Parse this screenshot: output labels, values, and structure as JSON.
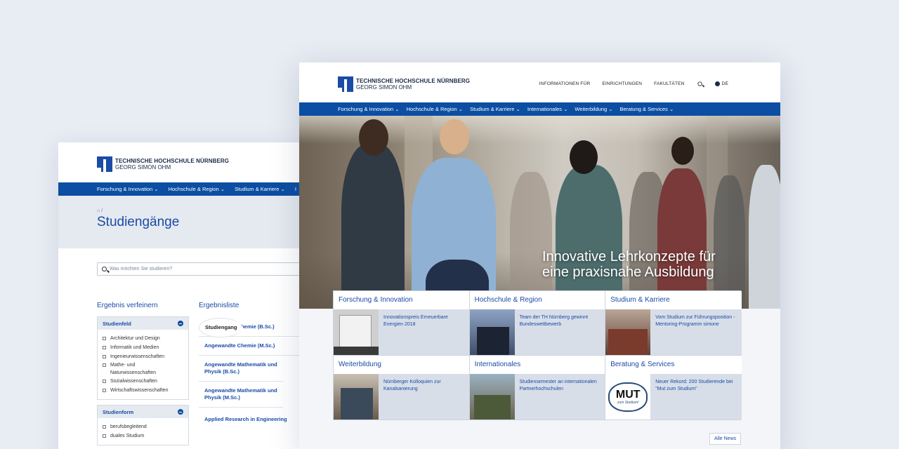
{
  "brand": {
    "line1": "TECHNISCHE HOCHSCHULE NÜRNBERG",
    "line2": "GEORG SIMON OHM",
    "accent": "#0b4ea2"
  },
  "back": {
    "nav": [
      "Forschung & Innovation ⌄",
      "Hochschule & Region ⌄",
      "Studium & Karriere ⌄",
      "I"
    ],
    "breadcrumb": "⌂ /",
    "title": "Studiengänge",
    "search_placeholder": "Was möchten Sie studieren?",
    "filter_title": "Ergebnis verfeinern",
    "filters": [
      {
        "name": "Studienfeld",
        "options": [
          "Architektur und Design",
          "Informatik und Medien",
          "Ingenieurwissenschaften",
          "Mathe- und Naturwissenschaften",
          "Sozialwissenschaften",
          "Wirtschaftswissenschaften"
        ]
      },
      {
        "name": "Studienform",
        "options": [
          "berufsbegleitend",
          "duales Studium"
        ]
      }
    ],
    "results_title": "Ergebnisliste",
    "results_header": "Studiengang",
    "results": [
      "Angewandte Chemie (B.Sc.)",
      "Angewandte Chemie (M.Sc.)",
      "Angewandte Mathematik und Physik (B.Sc.)",
      "Angewandte Mathematik und Physik (M.Sc.)",
      "Applied Research in Engineering"
    ]
  },
  "front": {
    "topnav": [
      "INFORMATIONEN FÜR",
      "EINRICHTUNGEN",
      "FAKULTÄTEN"
    ],
    "lang": "DE",
    "nav": [
      "Forschung & Innovation ⌄",
      "Hochschule & Region ⌄",
      "Studium & Karriere ⌄",
      "Internationales ⌄",
      "Weiterbildung ⌄",
      "Beratung & Services ⌄"
    ],
    "hero_line1": "Innovative Lehrkonzepte für",
    "hero_line2": "eine praxisnahe Ausbildung",
    "cards": [
      {
        "title": "Forschung & Innovation",
        "text": "Innovationspreis Erneuerbare Energien 2018"
      },
      {
        "title": "Hochschule & Region",
        "text": "Team der TH Nürnberg gewinnt Bundeswettbewerb"
      },
      {
        "title": "Studium & Karriere",
        "text": "Vom Studium zur Führungsposition - Mentoring-Programm simone"
      },
      {
        "title": "Weiterbildung",
        "text": "Nürnberger Kolloquien zur Kanalsanierung"
      },
      {
        "title": "Internationales",
        "text": "Studiensemester an internationalen Partnerhochschulen"
      },
      {
        "title": "Beratung & Services",
        "text": "Neuer Rekord: 200 Studierende bei \"Mut zum Studium\""
      }
    ],
    "mut_text": "MUT",
    "mut_sub": "zum Studium!",
    "all_news": "Alle News"
  }
}
